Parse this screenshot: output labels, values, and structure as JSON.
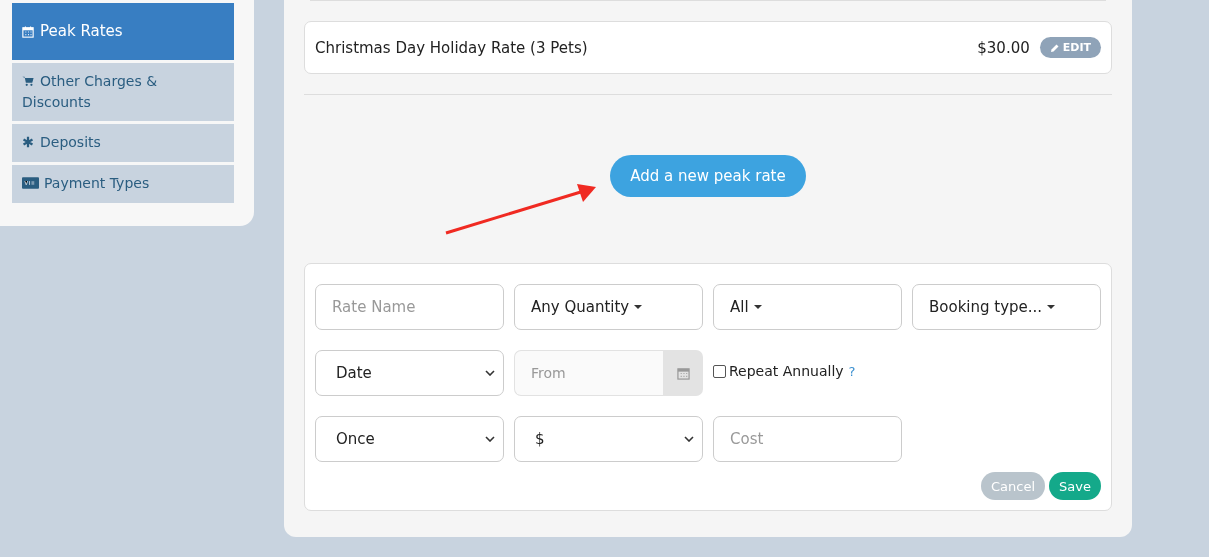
{
  "sidebar": {
    "items": [
      {
        "label": "Peak Rates",
        "selected": true
      },
      {
        "label": "Other Charges & Discounts",
        "selected": false
      },
      {
        "label": "Deposits",
        "selected": false
      },
      {
        "label": "Payment Types",
        "selected": false
      }
    ]
  },
  "rates": [
    {
      "name": "Christmas Day Holiday Rate (3 Pets)",
      "price": "$30.00",
      "action": "EDIT"
    }
  ],
  "add_button": "Add a new peak rate",
  "form": {
    "rows": [
      [
        {
          "kind": "input",
          "placeholder": "Rate Name"
        },
        {
          "kind": "dropdown",
          "value": "Any Quantity"
        },
        {
          "kind": "dropdown",
          "value": "All"
        },
        {
          "kind": "dropdown",
          "value": "Booking type..."
        }
      ],
      [
        {
          "kind": "select",
          "value": "Date"
        },
        {
          "kind": "date",
          "placeholder": "From"
        },
        {
          "kind": "checkbox",
          "label": "Repeat Annually",
          "checked": false,
          "help": "?"
        }
      ],
      [
        {
          "kind": "select",
          "value": "Once"
        },
        {
          "kind": "select",
          "value": "$"
        },
        {
          "kind": "input",
          "placeholder": "Cost"
        }
      ]
    ],
    "buttons": [
      {
        "label": "Cancel",
        "kind": "cancel"
      },
      {
        "label": "Save",
        "kind": "save"
      }
    ]
  }
}
